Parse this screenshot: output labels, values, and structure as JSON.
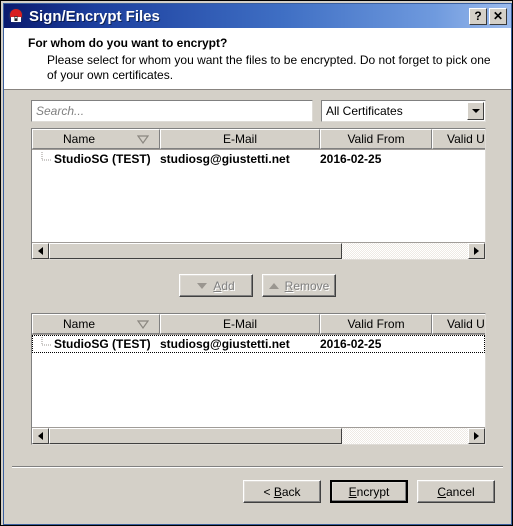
{
  "window": {
    "title": "Sign/Encrypt Files",
    "app_icon": "kleopatra-red-shield-icon",
    "help_button": "?",
    "close_button": "✕"
  },
  "banner": {
    "heading": "For whom do you want to encrypt?",
    "description": "Please select for whom you want the files to be encrypted. Do not forget to pick one of your own certificates."
  },
  "search": {
    "value": "",
    "placeholder": "Search..."
  },
  "filter": {
    "selected": "All Certificates",
    "options": [
      "All Certificates"
    ]
  },
  "columns": {
    "name": "Name",
    "email": "E-Mail",
    "valid_from": "Valid From",
    "valid_until": "Valid Unt"
  },
  "sort": {
    "column": "Name",
    "direction": "descending",
    "indicator": "triangle-down-outline-icon"
  },
  "available_list": {
    "rows": [
      {
        "name": "StudioSG (TEST)",
        "email": "studiosg@giustetti.net",
        "valid_from": "2016-02-25",
        "valid_until": ""
      }
    ]
  },
  "selected_list": {
    "rows": [
      {
        "name": "StudioSG (TEST)",
        "email": "studiosg@giustetti.net",
        "valid_from": "2016-02-25",
        "valid_until": ""
      }
    ]
  },
  "mid_buttons": {
    "add": "Add",
    "add_mnemonic": "A",
    "add_icon": "triangle-down-icon",
    "add_enabled": false,
    "remove": "Remove",
    "remove_mnemonic": "R",
    "remove_icon": "triangle-up-icon",
    "remove_enabled": false
  },
  "footer": {
    "back": "< Back",
    "back_mnemonic": "B",
    "encrypt": "Encrypt",
    "encrypt_mnemonic": "E",
    "cancel": "Cancel",
    "cancel_mnemonic": "C",
    "default_button": "Encrypt"
  },
  "scrollbars": {
    "left_arrow": "triangle-left-icon",
    "right_arrow": "triangle-right-icon",
    "thumb_fraction": 0.7
  },
  "colors": {
    "title_gradient_start": "#0a1a6e",
    "title_gradient_end": "#9dbced",
    "dialog_face": "#d4d0c8",
    "banner_bg": "#ffffff",
    "text": "#000000",
    "disabled_text": "#808080"
  }
}
